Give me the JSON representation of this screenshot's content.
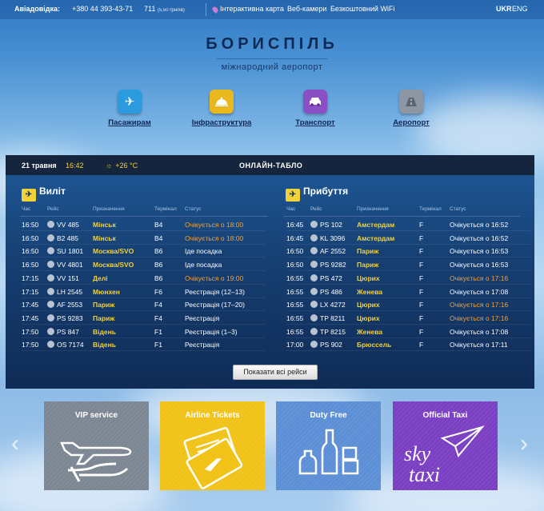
{
  "topbar": {
    "info_label": "Авіадовідка:",
    "phone": "+380 44 393-43-71",
    "short_number": "711",
    "short_price": "(5,50 грн/хв)",
    "map_link": "Інтерактивна карта",
    "webcams_link": "Веб-камери",
    "wifi_link": "Безкоштовний WiFi",
    "lang_ukr": "UKR",
    "lang_eng": "ENG"
  },
  "header": {
    "title": "БОРИСПІЛЬ",
    "subtitle": "міжнародний аеропорт"
  },
  "nav": [
    {
      "label": "Пасажирам",
      "icon": "plane-icon",
      "color": "#2b9be0"
    },
    {
      "label": "Інфраструктура",
      "icon": "food-cloche-icon",
      "color": "#e8b81c"
    },
    {
      "label": "Транспорт",
      "icon": "car-icon",
      "color": "#8a4fc4"
    },
    {
      "label": "Аеропорт",
      "icon": "runway-icon",
      "color": "#8d96a3"
    }
  ],
  "board": {
    "date": "21 травня",
    "time": "16:42",
    "temperature": "+26 °C",
    "title": "ОНЛАЙН-ТАБЛО",
    "show_all_button": "Показати всі рейси",
    "departures": {
      "heading": "Виліт",
      "columns": [
        "Час",
        "Рейс",
        "Призначення",
        "Термінал",
        "Статус"
      ],
      "rows": [
        {
          "time": "16:50",
          "flight": "VV 485",
          "dest": "Мінськ",
          "terminal": "B4",
          "status": "Очікується о 18:00",
          "highlight": true
        },
        {
          "time": "16:50",
          "flight": "B2 485",
          "dest": "Мінськ",
          "terminal": "B4",
          "status": "Очікується о 18:00",
          "highlight": true
        },
        {
          "time": "16:50",
          "flight": "SU 1801",
          "dest": "Москва/SVO",
          "terminal": "B6",
          "status": "Іде посадка",
          "highlight": false
        },
        {
          "time": "16:50",
          "flight": "VV 4801",
          "dest": "Москва/SVO",
          "terminal": "B6",
          "status": "Іде посадка",
          "highlight": false
        },
        {
          "time": "17:15",
          "flight": "VV 151",
          "dest": "Делі",
          "terminal": "B6",
          "status": "Очікується о 19:00",
          "highlight": true
        },
        {
          "time": "17:15",
          "flight": "LH 2545",
          "dest": "Мюнхен",
          "terminal": "F6",
          "status": "Реєстрація (12–13)",
          "highlight": false
        },
        {
          "time": "17:45",
          "flight": "AF 2553",
          "dest": "Париж",
          "terminal": "F4",
          "status": "Реєстрація (17–20)",
          "highlight": false
        },
        {
          "time": "17:45",
          "flight": "PS 9283",
          "dest": "Париж",
          "terminal": "F4",
          "status": "Реєстрація",
          "highlight": false
        },
        {
          "time": "17:50",
          "flight": "PS 847",
          "dest": "Відень",
          "terminal": "F1",
          "status": "Реєстрація (1–3)",
          "highlight": false
        },
        {
          "time": "17:50",
          "flight": "OS 7174",
          "dest": "Відень",
          "terminal": "F1",
          "status": "Реєстрація",
          "highlight": false
        }
      ]
    },
    "arrivals": {
      "heading": "Прибуття",
      "columns": [
        "Час",
        "Рейс",
        "Призначення",
        "Термінал",
        "Статус"
      ],
      "rows": [
        {
          "time": "16:45",
          "flight": "PS 102",
          "dest": "Амстердам",
          "terminal": "F",
          "status": "Очікується о 16:52",
          "highlight": false
        },
        {
          "time": "16:45",
          "flight": "KL 3096",
          "dest": "Амстердам",
          "terminal": "F",
          "status": "Очікується о 16:52",
          "highlight": false
        },
        {
          "time": "16:50",
          "flight": "AF 2552",
          "dest": "Париж",
          "terminal": "F",
          "status": "Очікується о 16:53",
          "highlight": false
        },
        {
          "time": "16:50",
          "flight": "PS 9282",
          "dest": "Париж",
          "terminal": "F",
          "status": "Очікується о 16:53",
          "highlight": false
        },
        {
          "time": "16:55",
          "flight": "PS 472",
          "dest": "Цюрих",
          "terminal": "F",
          "status": "Очікується о 17:16",
          "highlight": true
        },
        {
          "time": "16:55",
          "flight": "PS 486",
          "dest": "Женева",
          "terminal": "F",
          "status": "Очікується о 17:08",
          "highlight": false
        },
        {
          "time": "16:55",
          "flight": "LX 4272",
          "dest": "Цюрих",
          "terminal": "F",
          "status": "Очікується о 17:16",
          "highlight": true
        },
        {
          "time": "16:55",
          "flight": "TP 8211",
          "dest": "Цюрих",
          "terminal": "F",
          "status": "Очікується о 17:16",
          "highlight": true
        },
        {
          "time": "16:55",
          "flight": "TP 8215",
          "dest": "Женева",
          "terminal": "F",
          "status": "Очікується о 17:08",
          "highlight": false
        },
        {
          "time": "17:00",
          "flight": "PS 902",
          "dest": "Брюссель",
          "terminal": "F",
          "status": "Очікується о 17:11",
          "highlight": false
        }
      ]
    }
  },
  "promos": [
    {
      "title": "VIP service",
      "color": "#7c8793",
      "icon": "vip-plane-hand-icon"
    },
    {
      "title": "Airline Tickets",
      "color": "#f1c318",
      "icon": "tickets-icon"
    },
    {
      "title": "Duty Free",
      "color": "#5c8fd6",
      "icon": "bottles-icon"
    },
    {
      "title": "Official Taxi",
      "color": "#7a3fc2",
      "icon": "sky-taxi-logo",
      "logo_text": [
        "sky",
        "taxi"
      ]
    }
  ],
  "colors": {
    "accent_yellow": "#f2d13a",
    "status_orange": "#f2a23a",
    "board_dark": "#15253d"
  }
}
